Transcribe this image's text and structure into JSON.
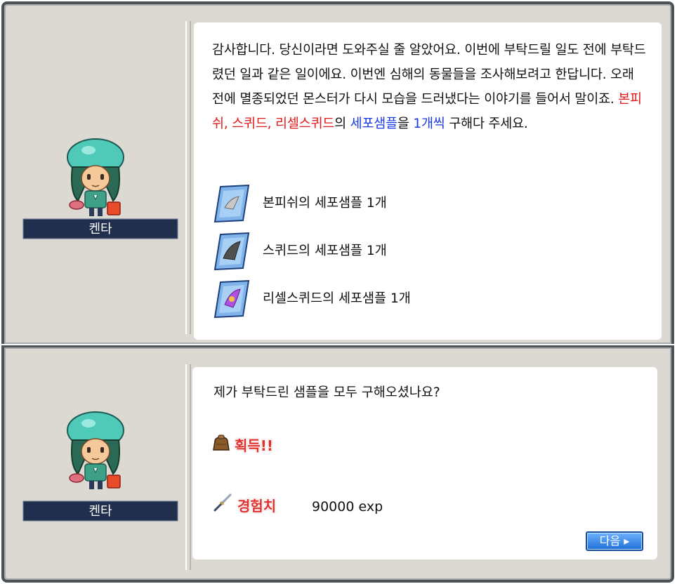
{
  "dialog1": {
    "npc_name": "켄타",
    "text_1": "감사합니다. 당신이라면 도와주실 줄 알았어요. 이번에 부탁드릴 일도 전에 부탁드렸던 일과 같은 일이에요. 이번엔 심해의 동물들을 조사해보려고 한답니다. 오래 전에 멸종되었던 몬스터가 다시 모습을 드러냈다는 이야기를 들어서 말이죠. ",
    "highlight_red": "본피쉬, 스퀴드, 리셀스퀴드",
    "text_2": "의 ",
    "highlight_blue_1": "세포샘플",
    "text_3": "을 ",
    "highlight_blue_2": "1개씩",
    "text_4": " 구해다 주세요.",
    "items": [
      {
        "label": "본피쉬의 세포샘플 1개",
        "icon": "bonefish-sample-icon",
        "color": "#c8c8c8"
      },
      {
        "label": "스퀴드의 세포샘플 1개",
        "icon": "squid-sample-icon",
        "color": "#505050"
      },
      {
        "label": "리셀스퀴드의 세포샘플 1개",
        "icon": "risell-squid-sample-icon",
        "color": "#b050e0"
      }
    ]
  },
  "dialog2": {
    "npc_name": "켄타",
    "question": "제가 부탁드린 샘플을 모두 구해오셨나요?",
    "gain_label": "획득!!",
    "exp_label": "경험치",
    "exp_value": "90000 exp",
    "next_button": "다음 ▸"
  },
  "colors": {
    "highlight_red": "#e11a1a",
    "highlight_blue": "#1a3ae1",
    "nameplate": "#1f2f4d",
    "frame": "#4d5156"
  }
}
